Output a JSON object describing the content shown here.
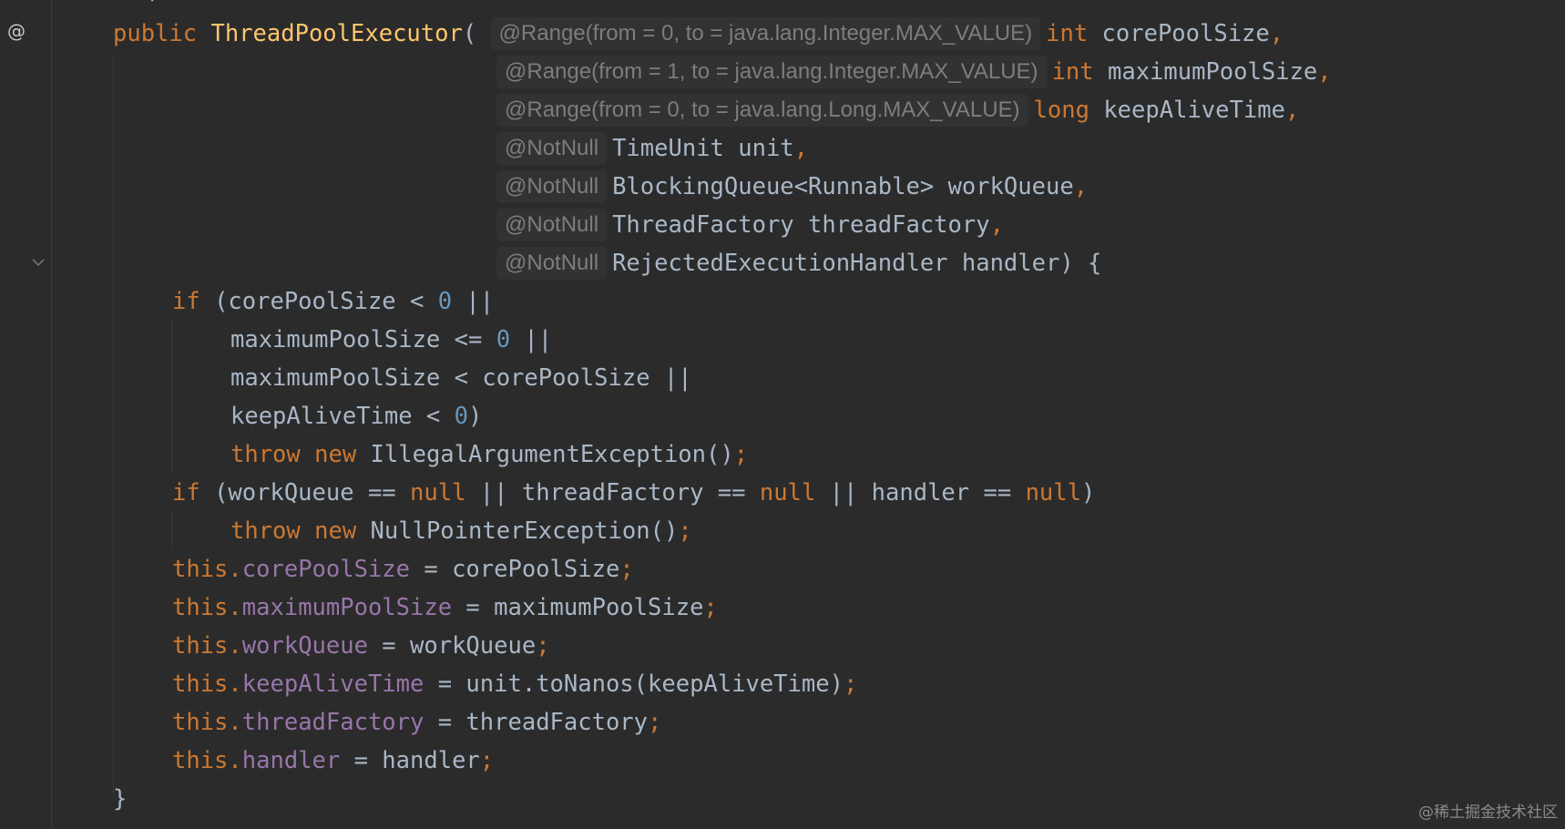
{
  "gutter": {
    "annotation_marker": "@",
    "fold_icon": "chevron-down-icon"
  },
  "colors": {
    "background": "#2b2b2b",
    "keyword": "#cc7832",
    "method": "#ffc66d",
    "number": "#6897bb",
    "field": "#9876aa",
    "text": "#a9b7c6",
    "hint": "#7d7d7d"
  },
  "code": {
    "top_stub": "*/",
    "l1": {
      "kw": "public",
      "method": "ThreadPoolExecutor",
      "paren": "(",
      "hint": "@Range(from = 0, to = java.lang.Integer.MAX_VALUE)",
      "type": "int",
      "name": "corePoolSize",
      "comma": ","
    },
    "l2": {
      "hint": "@Range(from = 1, to = java.lang.Integer.MAX_VALUE)",
      "type": "int",
      "name": "maximumPoolSize",
      "comma": ","
    },
    "l3": {
      "hint": "@Range(from = 0, to = java.lang.Long.MAX_VALUE)",
      "type": "long",
      "name": "keepAliveTime",
      "comma": ","
    },
    "l4": {
      "hint": "@NotNull",
      "text": "TimeUnit unit",
      "comma": ","
    },
    "l5": {
      "hint": "@NotNull",
      "text": "BlockingQueue<Runnable> workQueue",
      "comma": ","
    },
    "l6": {
      "hint": "@NotNull",
      "text": "ThreadFactory threadFactory",
      "comma": ","
    },
    "l7": {
      "hint": "@NotNull",
      "text": "RejectedExecutionHandler handler) {"
    },
    "l8": {
      "kw": "if",
      "a": " (corePoolSize < ",
      "num": "0",
      "b": " ||"
    },
    "l9": {
      "a": "maximumPoolSize <= ",
      "num": "0",
      "b": " ||"
    },
    "l10": {
      "a": "maximumPoolSize < corePoolSize ||"
    },
    "l11": {
      "a": "keepAliveTime < ",
      "num": "0",
      "b": ")"
    },
    "l12": {
      "kw1": "throw",
      "kw2": "new",
      "a": "IllegalArgumentException()",
      "semi": ";"
    },
    "l13": {
      "kw": "if",
      "a": " (workQueue == ",
      "null1": "null",
      "b": " || threadFactory == ",
      "null2": "null",
      "c": " || handler == ",
      "null3": "null",
      "d": ")"
    },
    "l14": {
      "kw1": "throw",
      "kw2": "new",
      "a": "NullPointerException()",
      "semi": ";"
    },
    "l15": {
      "this": "this",
      "dot": ".",
      "field": "corePoolSize",
      "a": " = corePoolSize",
      "semi": ";"
    },
    "l16": {
      "this": "this",
      "dot": ".",
      "field": "maximumPoolSize",
      "a": " = maximumPoolSize",
      "semi": ";"
    },
    "l17": {
      "this": "this",
      "dot": ".",
      "field": "workQueue",
      "a": " = workQueue",
      "semi": ";"
    },
    "l18": {
      "this": "this",
      "dot": ".",
      "field": "keepAliveTime",
      "a": " = unit.toNanos(keepAliveTime)",
      "semi": ";"
    },
    "l19": {
      "this": "this",
      "dot": ".",
      "field": "threadFactory",
      "a": " = threadFactory",
      "semi": ";"
    },
    "l20": {
      "this": "this",
      "dot": ".",
      "field": "handler",
      "a": " = handler",
      "semi": ";"
    },
    "l21": {
      "brace": "}"
    }
  },
  "watermark": "@稀土掘金技术社区"
}
